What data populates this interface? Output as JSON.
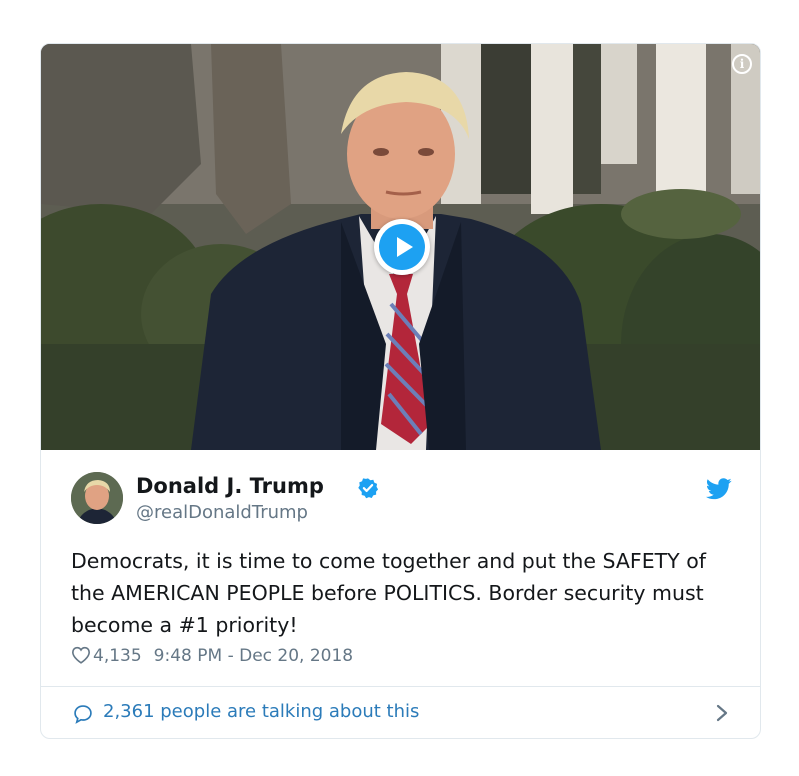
{
  "tweet": {
    "display_name": "Donald J. Trump",
    "handle": "@realDonaldTrump",
    "text": "Democrats, it is time to come together and put the SAFETY of the AMERICAN PEOPLE before POLITICS. Border security must become a #1 priority!",
    "likes": "4,135",
    "timestamp": "9:48 PM - Dec 20, 2018",
    "talking": "2,361 people are talking about this",
    "verified": true
  },
  "media": {
    "type": "video",
    "info_glyph": "i"
  },
  "icons": {
    "info": "info-icon",
    "play": "play-icon",
    "verified": "verified-badge-icon",
    "twitter": "twitter-bird-icon",
    "like": "heart-icon",
    "reply": "speech-bubble-icon",
    "chevron": "chevron-right-icon"
  },
  "colors": {
    "brand_blue": "#1da1f2",
    "link_blue": "#2b7bb9",
    "text_primary": "#14171a",
    "text_secondary": "#657786",
    "border": "#e1e8ed"
  }
}
